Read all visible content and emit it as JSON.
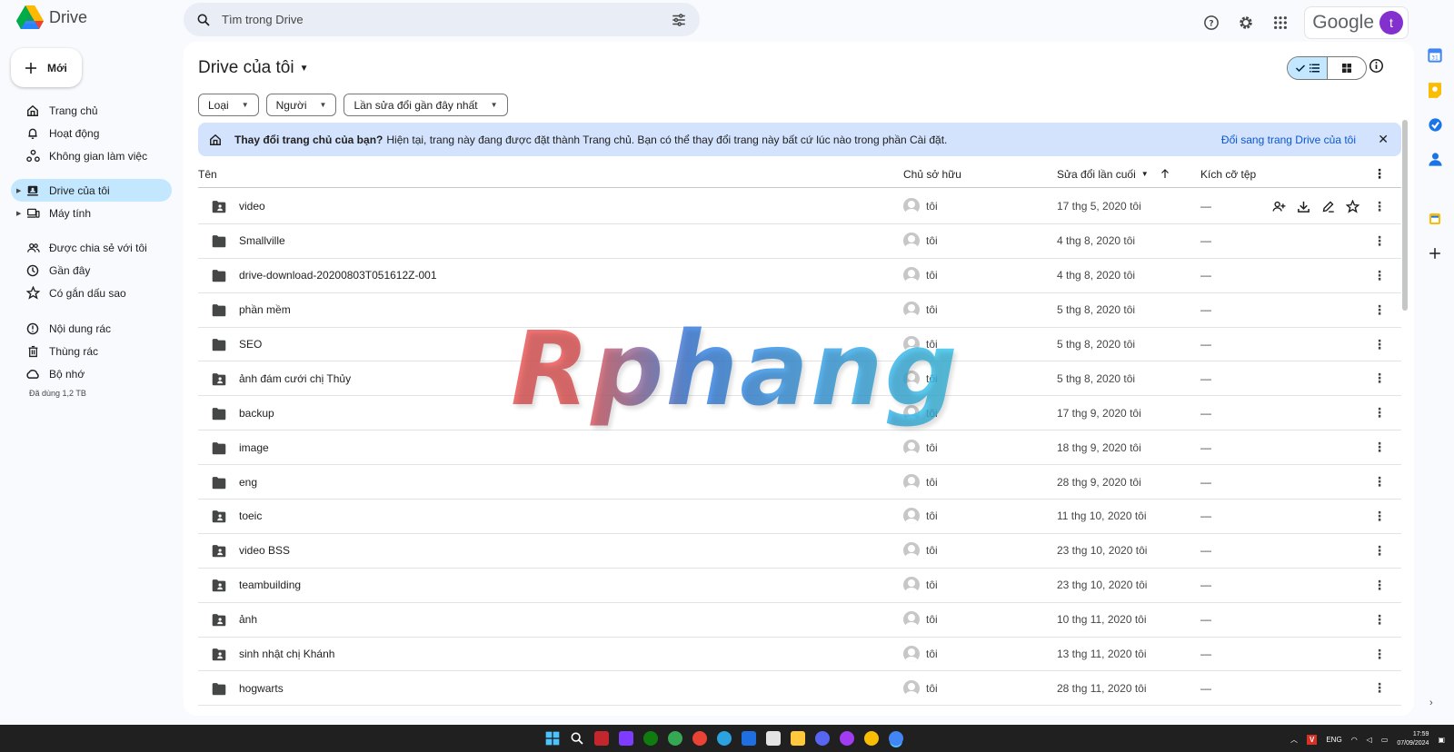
{
  "app": {
    "name": "Drive"
  },
  "search": {
    "placeholder": "Tìm trong Drive"
  },
  "header": {
    "google_label": "Google",
    "avatar_letter": "t"
  },
  "sidebar": {
    "new_label": "Mới",
    "items": [
      {
        "label": "Trang chủ",
        "icon": "home-icon"
      },
      {
        "label": "Hoạt động",
        "icon": "bell-icon"
      },
      {
        "label": "Không gian làm việc",
        "icon": "workspace-icon"
      },
      {
        "label": "Drive của tôi",
        "icon": "my-drive-icon",
        "active": true
      },
      {
        "label": "Máy tính",
        "icon": "computer-icon"
      },
      {
        "label": "Được chia sẻ với tôi",
        "icon": "shared-icon"
      },
      {
        "label": "Gần đây",
        "icon": "clock-icon"
      },
      {
        "label": "Có gắn dấu sao",
        "icon": "star-icon"
      },
      {
        "label": "Nội dung rác",
        "icon": "spam-icon"
      },
      {
        "label": "Thùng rác",
        "icon": "trash-icon"
      },
      {
        "label": "Bộ nhớ",
        "icon": "cloud-icon"
      }
    ],
    "storage_note": "Đã dùng 1,2 TB"
  },
  "main": {
    "title": "Drive của tôi",
    "filters": [
      "Loại",
      "Người",
      "Lần sửa đổi gần đây nhất"
    ],
    "banner": {
      "bold": "Thay đổi trang chủ của bạn?",
      "text": "Hiện tại, trang này đang được đặt thành Trang chủ. Bạn có thể thay đổi trang này bất cứ lúc nào trong phần Cài đặt.",
      "link": "Đổi sang trang Drive của tôi"
    },
    "columns": {
      "name": "Tên",
      "owner": "Chủ sở hữu",
      "modified": "Sửa đổi lần cuối",
      "size": "Kích cỡ tệp"
    },
    "rows": [
      {
        "name": "video",
        "shared": true,
        "owner": "tôi",
        "modified": "17 thg 5, 2020 tôi",
        "size": "—"
      },
      {
        "name": "Smallville",
        "shared": false,
        "owner": "tôi",
        "modified": "4 thg 8, 2020 tôi",
        "size": "—"
      },
      {
        "name": "drive-download-20200803T051612Z-001",
        "shared": false,
        "owner": "tôi",
        "modified": "4 thg 8, 2020 tôi",
        "size": "—"
      },
      {
        "name": "phần mềm",
        "shared": false,
        "owner": "tôi",
        "modified": "5 thg 8, 2020 tôi",
        "size": "—"
      },
      {
        "name": "SEO",
        "shared": false,
        "owner": "tôi",
        "modified": "5 thg 8, 2020 tôi",
        "size": "—"
      },
      {
        "name": "ảnh đám cưới chị Thủy",
        "shared": true,
        "owner": "tôi",
        "modified": "5 thg 8, 2020 tôi",
        "size": "—"
      },
      {
        "name": "backup",
        "shared": false,
        "owner": "tôi",
        "modified": "17 thg 9, 2020 tôi",
        "size": "—"
      },
      {
        "name": "image",
        "shared": false,
        "owner": "tôi",
        "modified": "18 thg 9, 2020 tôi",
        "size": "—"
      },
      {
        "name": "eng",
        "shared": false,
        "owner": "tôi",
        "modified": "28 thg 9, 2020 tôi",
        "size": "—"
      },
      {
        "name": "toeic",
        "shared": true,
        "owner": "tôi",
        "modified": "11 thg 10, 2020 tôi",
        "size": "—"
      },
      {
        "name": "video BSS",
        "shared": true,
        "owner": "tôi",
        "modified": "23 thg 10, 2020 tôi",
        "size": "—"
      },
      {
        "name": "teambuilding",
        "shared": true,
        "owner": "tôi",
        "modified": "23 thg 10, 2020 tôi",
        "size": "—"
      },
      {
        "name": "ảnh",
        "shared": true,
        "owner": "tôi",
        "modified": "10 thg 11, 2020 tôi",
        "size": "—"
      },
      {
        "name": "sinh nhật chị Khánh",
        "shared": true,
        "owner": "tôi",
        "modified": "13 thg 11, 2020 tôi",
        "size": "—"
      },
      {
        "name": "hogwarts",
        "shared": false,
        "owner": "tôi",
        "modified": "28 thg 11, 2020 tôi",
        "size": "—"
      }
    ]
  },
  "watermark": "Rphang",
  "taskbar": {
    "lang": "ENG",
    "time": "17:59",
    "date": "07/09/2024"
  }
}
